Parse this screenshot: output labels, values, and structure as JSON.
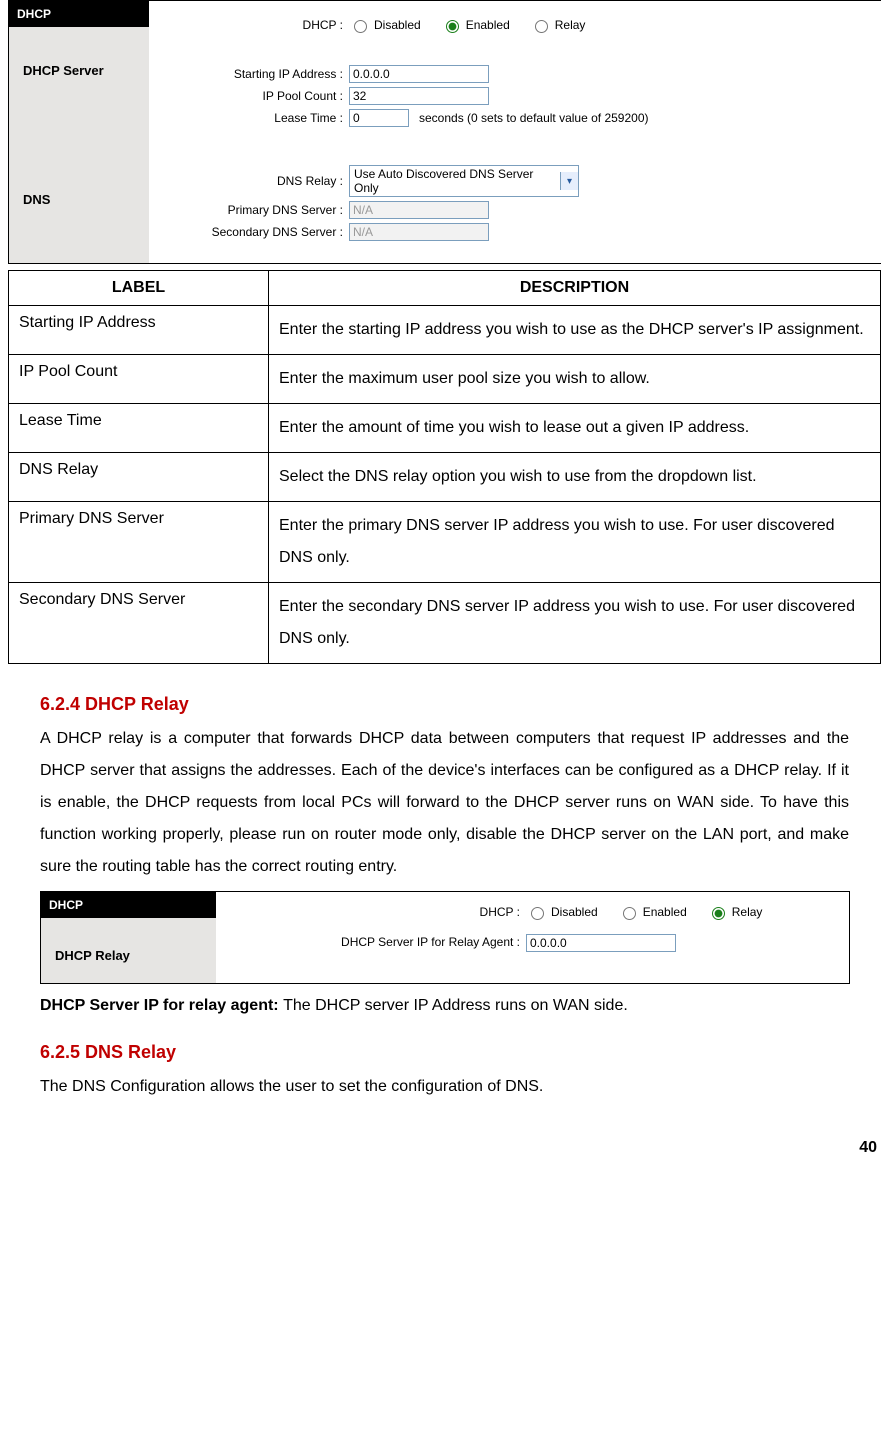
{
  "shot1": {
    "tab": "DHCP",
    "section_dhcp_server": "DHCP Server",
    "section_dns": "DNS",
    "dhcp_label": "DHCP :",
    "dhcp_options": {
      "disabled": "Disabled",
      "enabled": "Enabled",
      "relay": "Relay"
    },
    "dhcp_selected": "enabled",
    "starting_ip_label": "Starting IP Address :",
    "starting_ip_value": "0.0.0.0",
    "ip_pool_label": "IP Pool Count :",
    "ip_pool_value": "32",
    "lease_label": "Lease Time :",
    "lease_value": "0",
    "lease_suffix": "seconds    (0 sets to default value of 259200)",
    "dns_relay_label": "DNS Relay :",
    "dns_relay_selected": "Use Auto Discovered DNS Server Only",
    "primary_dns_label": "Primary DNS Server   :",
    "primary_dns_value": "N/A",
    "secondary_dns_label": "Secondary DNS Server :",
    "secondary_dns_value": "N/A"
  },
  "table": {
    "col_label": "LABEL",
    "col_desc": "DESCRIPTION",
    "rows": [
      {
        "label": "Starting IP Address",
        "desc": "Enter the starting IP address you wish to use as the DHCP server's IP assignment."
      },
      {
        "label": "IP Pool Count",
        "desc": "Enter the maximum user pool size you wish to allow."
      },
      {
        "label": "Lease Time",
        "desc": "Enter the amount of time you wish to lease out a given IP address."
      },
      {
        "label": "DNS Relay",
        "desc": "Select the DNS relay option you wish to use from the dropdown list."
      },
      {
        "label": "Primary DNS Server",
        "desc": "Enter the primary DNS server IP address you wish to use. For user discovered DNS only."
      },
      {
        "label": "Secondary DNS Server",
        "desc": "Enter the secondary DNS server IP address you wish to use. For user discovered DNS only."
      }
    ]
  },
  "sec624": {
    "heading": "6.2.4 DHCP Relay",
    "para": "A DHCP relay is a computer that forwards DHCP data between computers that request IP addresses and the DHCP server that assigns the addresses. Each of the device's interfaces can be configured as a DHCP relay. If it is enable, the DHCP requests from local PCs will forward to the DHCP server runs on WAN side. To have this function working properly, please run on router mode only, disable the DHCP server on the LAN port, and make sure the routing table has the correct routing entry."
  },
  "shot2": {
    "tab": "DHCP",
    "section": "DHCP Relay",
    "dhcp_label": "DHCP :",
    "dhcp_options": {
      "disabled": "Disabled",
      "enabled": "Enabled",
      "relay": "Relay"
    },
    "dhcp_selected": "relay",
    "relay_ip_label": "DHCP Server IP for Relay Agent :",
    "relay_ip_value": "0.0.0.0"
  },
  "relay_ip_caption_bold": "DHCP Server IP for relay agent: ",
  "relay_ip_caption_rest": "The DHCP server IP Address runs on WAN side.",
  "sec625": {
    "heading": "6.2.5 DNS Relay",
    "para": "The DNS Configuration allows the user to set the configuration of DNS."
  },
  "page_number": "40"
}
